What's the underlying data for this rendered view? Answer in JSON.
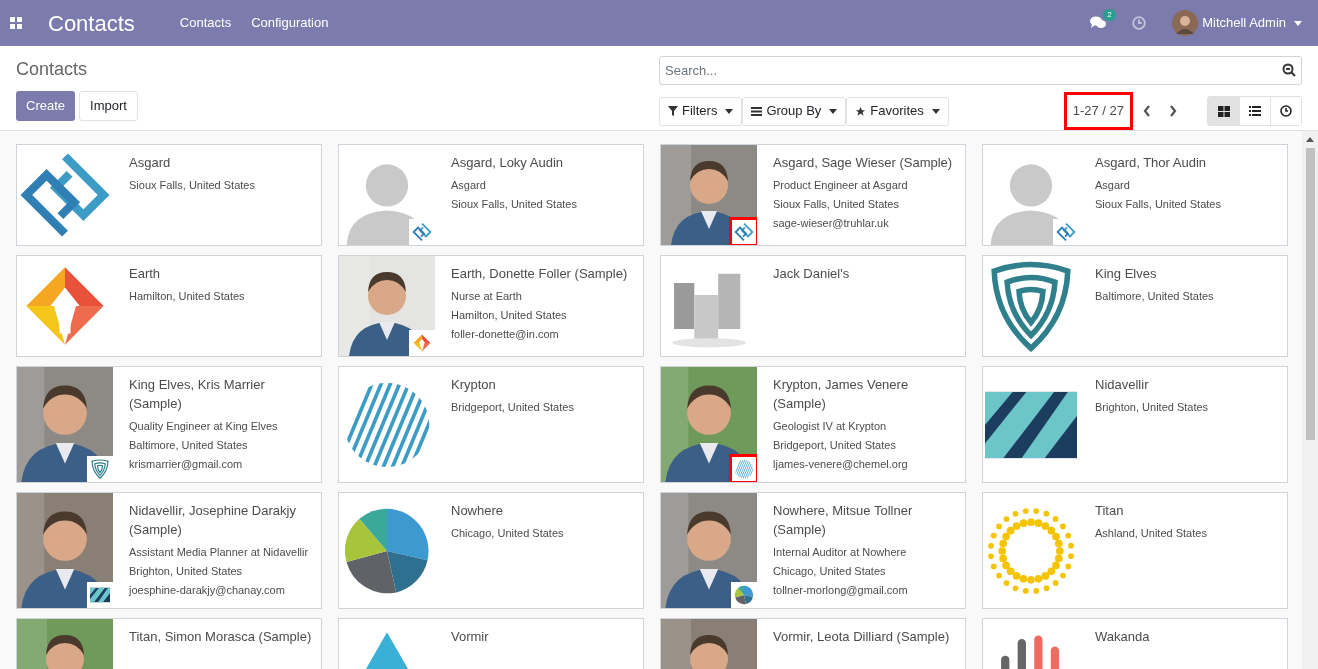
{
  "navbar": {
    "app_title": "Contacts",
    "menu": [
      "Contacts",
      "Configuration"
    ],
    "messages_count": "2",
    "user": "Mitchell Admin"
  },
  "control_panel": {
    "title": "Contacts",
    "buttons": [
      "Create",
      "Import"
    ],
    "search": {
      "placeholder": "Search..."
    },
    "filters": [
      "Filters",
      "Group By",
      "Favorites"
    ],
    "pager": {
      "text": "1-27 / 27",
      "highlighted": true
    },
    "views": [
      {
        "kind": "kanban",
        "selected": true
      },
      {
        "kind": "list",
        "selected": false
      },
      {
        "kind": "activity",
        "selected": false
      }
    ]
  },
  "cards": [
    {
      "title": "Asgard",
      "lines": [
        "Sioux Falls, United States"
      ],
      "image": {
        "kind": "spiral"
      }
    },
    {
      "title": "Asgard, Loky Audin",
      "lines": [
        "Asgard",
        "Sioux Falls, United States"
      ],
      "image": {
        "kind": "silhouette"
      },
      "badge": {
        "kind": "spiral",
        "highlighted": false
      }
    },
    {
      "title": "Asgard, Sage Wieser (Sample)",
      "lines": [
        "Product Engineer at Asgard",
        "Sioux Falls, United States",
        "sage-wieser@truhlar.uk"
      ],
      "badge": {
        "kind": "spiral",
        "highlighted": true
      }
    },
    {
      "title": "Asgard, Thor Audin",
      "lines": [
        "Asgard",
        "Sioux Falls, United States"
      ],
      "image": {
        "kind": "silhouette"
      },
      "badge": {
        "kind": "spiral",
        "highlighted": false
      }
    },
    {
      "title": "Earth",
      "lines": [
        "Hamilton, United States"
      ],
      "image": {
        "kind": "diamond"
      }
    },
    {
      "title": "Earth, Donette Foller (Sample)",
      "lines": [
        "Nurse at Earth",
        "Hamilton, United States",
        "foller-donette@in.com"
      ],
      "badge": {
        "kind": "diamond",
        "highlighted": false
      }
    },
    {
      "title": "Jack Daniel's",
      "image": {
        "kind": "buildings"
      }
    },
    {
      "title": "King Elves",
      "lines": [
        "Baltimore, United States"
      ],
      "image": {
        "kind": "shield"
      }
    },
    {
      "title": "King Elves, Kris Marrier (Sample)",
      "lines": [
        "Quality Engineer at King Elves",
        "Baltimore, United States",
        "krismarrier@gmail.com"
      ],
      "badge": {
        "kind": "shield",
        "highlighted": false
      }
    },
    {
      "title": "Krypton",
      "lines": [
        "Bridgeport, United States"
      ],
      "image": {
        "kind": "striped-circle"
      }
    },
    {
      "title": "Krypton, James Venere (Sample)",
      "lines": [
        "Geologist IV at Krypton",
        "Bridgeport, United States",
        "ljames-venere@chemel.org"
      ],
      "badge": {
        "kind": "striped-circle",
        "highlighted": true
      }
    },
    {
      "title": "Nidavellir",
      "lines": [
        "Brighton, United States"
      ],
      "image": {
        "kind": "stripes"
      }
    },
    {
      "title": "Nidavellir, Josephine Darakjy (Sample)",
      "lines": [
        "Assistant Media Planner at Nidavellir",
        "Brighton, United States",
        "joesphine-darakjy@chanay.com"
      ],
      "badge": {
        "kind": "stripes",
        "highlighted": false
      }
    },
    {
      "title": "Nowhere",
      "lines": [
        "Chicago, United States"
      ],
      "image": {
        "kind": "pie"
      }
    },
    {
      "title": "Nowhere, Mitsue Tollner (Sample)",
      "lines": [
        "Internal Auditor at Nowhere",
        "Chicago, United States",
        "tollner-morlong@gmail.com"
      ],
      "badge": {
        "kind": "pie",
        "highlighted": false
      }
    },
    {
      "title": "Titan",
      "lines": [
        "Ashland, United States"
      ],
      "image": {
        "kind": "dots"
      }
    },
    {
      "title": "Titan, Simon Morasca (Sample)"
    },
    {
      "title": "Vormir",
      "image": {
        "kind": "triangle"
      }
    },
    {
      "title": "Vormir, Leota Dilliard (Sample)"
    },
    {
      "title": "Wakanda",
      "image": {
        "kind": "bars"
      }
    }
  ]
}
